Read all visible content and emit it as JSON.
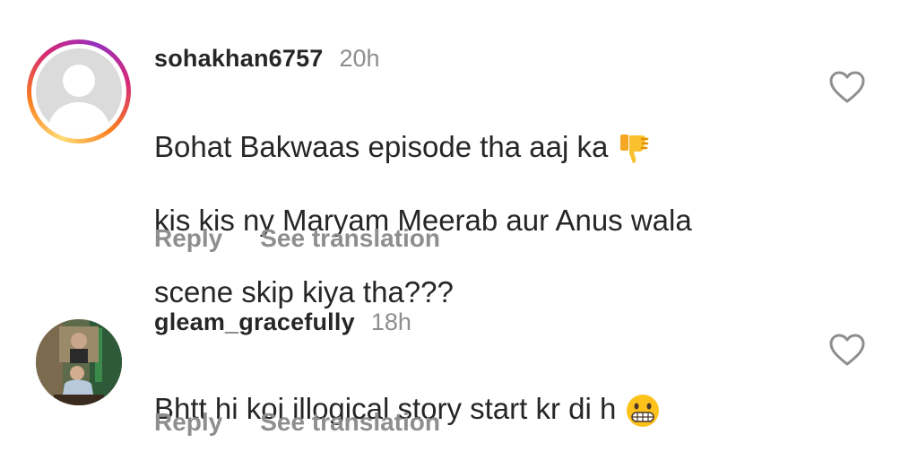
{
  "comments": [
    {
      "username": "sohakhan6757",
      "time": "20h",
      "text_line1": "Bohat Bakwaas episode tha aaj ka ",
      "text_line2": "kis kis ny Maryam Meerab aur Anus wala",
      "text_line3": "scene skip kiya tha???",
      "emoji": "thumbs-down-icon",
      "reply_label": "Reply",
      "translate_label": "See translation",
      "has_story_ring": true
    },
    {
      "username": "gleam_gracefully",
      "time": "18h",
      "text_line1": "Bhtt hi koi illogical story start kr di h ",
      "emoji": "grimacing-face-icon",
      "reply_label": "Reply",
      "translate_label": "See translation",
      "has_story_ring": false
    }
  ],
  "colors": {
    "text": "#262626",
    "secondary": "#8e8e8e",
    "heart_outline": "#8e8e8e"
  }
}
